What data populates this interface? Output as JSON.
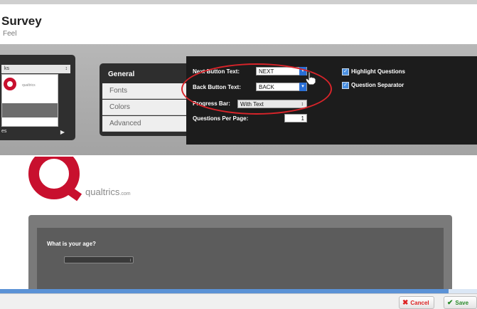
{
  "header": {
    "title": "Survey",
    "subtitle": "Feel"
  },
  "theme_picker": {
    "selected": "ks",
    "preview_text": "qualtrics",
    "bottom_label": "es"
  },
  "nav": {
    "heading": "General",
    "items": [
      "Fonts",
      "Colors",
      "Advanced"
    ]
  },
  "settings": {
    "next_label": "Next Button Text:",
    "next_value": "NEXT",
    "back_label": "Back Button Text:",
    "back_value": "BACK",
    "progress_label": "Progress Bar:",
    "progress_value": "With Text",
    "qpp_label": "Questions Per Page:",
    "qpp_value": "1",
    "highlight_label": "Highlight Questions",
    "separator_label": "Question Separator"
  },
  "preview": {
    "brand": "qualtrics",
    "brand_suffix": ".com",
    "question": "What is your age?"
  },
  "footer": {
    "cancel_label": "Cancel",
    "save_label": "Save"
  },
  "colors": {
    "accent_red": "#c8102e",
    "highlight_oval": "#d8242a",
    "select_blue": "#2a6fd6"
  },
  "progress_fraction": 0.94
}
